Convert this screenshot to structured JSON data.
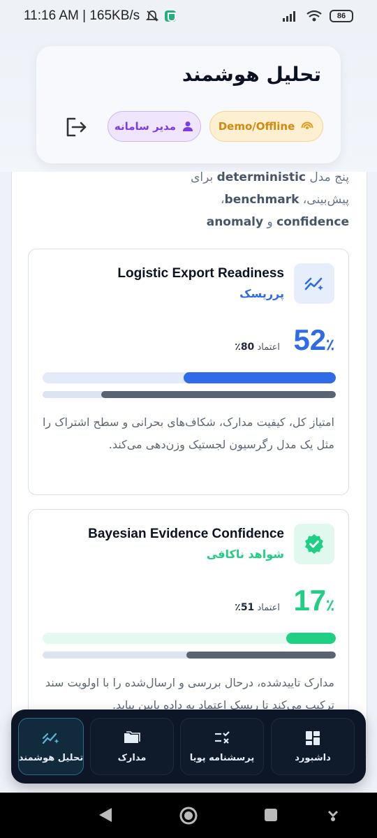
{
  "status_bar": {
    "time_speed": "11:16 AM | 165KB/s",
    "battery": "86"
  },
  "header": {
    "title": "تحلیل هوشمند",
    "demo_badge": "Demo/Offline",
    "admin_badge": "مدیر سامانه"
  },
  "intro": {
    "line1_prefix": "پنج مدل ",
    "line1_bold": "deterministic",
    "line1_suffix": " برای",
    "line2_prefix": "پیش‌بینی، ",
    "line2_bold": "benchmark",
    "line2_suffix": "،",
    "line3_bold1": "confidence",
    "line3_mid": " و ",
    "line3_bold2": "anomaly"
  },
  "cards": [
    {
      "title": "Logistic Export Readiness",
      "subtitle": "پرریسک",
      "percent": "52",
      "percent_sign": "٪",
      "confidence_label": "اعتماد",
      "confidence_value": "80٪",
      "score_fraction": 0.52,
      "confidence_fraction": 0.8,
      "description": "امتیاز کل، کیفیت مدارک، شکاف‌های بحرانی و سطح اشتراک را مثل یک مدل رگرسیون لجستیک وزن‌دهی می‌کند.",
      "accent": "#2f6be6"
    },
    {
      "title": "Bayesian Evidence Confidence",
      "subtitle": "شواهد ناکافی",
      "percent": "17",
      "percent_sign": "٪",
      "confidence_label": "اعتماد",
      "confidence_value": "51٪",
      "score_fraction": 0.17,
      "confidence_fraction": 0.51,
      "description": "مدارک تاییدشده، درحال بررسی و ارسال‌شده را با اولویت سند ترکیب می‌کند تا ریسک اعتماد به داده پایین بیاید.",
      "accent": "#1fcf83"
    }
  ],
  "bottom_nav": [
    {
      "label": "داشبورد",
      "icon": "dashboard-icon"
    },
    {
      "label": "پرسشنامه پویا",
      "icon": "checklist-icon"
    },
    {
      "label": "مدارک",
      "icon": "folder-icon"
    },
    {
      "label": "تحلیل هوشمند",
      "icon": "analytics-icon",
      "active": true
    }
  ]
}
